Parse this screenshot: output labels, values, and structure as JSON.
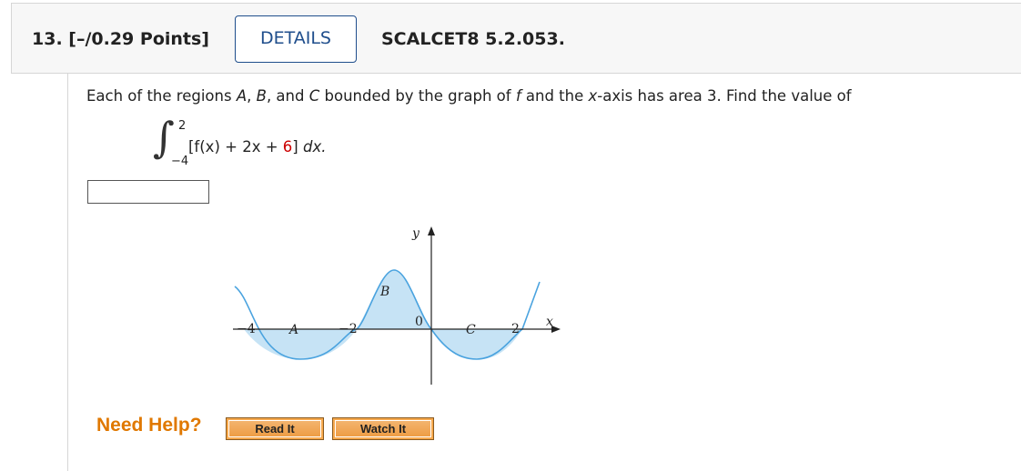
{
  "header": {
    "question_label": "13. [–/0.29 Points]",
    "details_label": "DETAILS",
    "code": "SCALCET8 5.2.053."
  },
  "problem": {
    "prompt_before_f": "Each of the regions ",
    "region_a": "A",
    "comma_sep": ", ",
    "region_b": "B",
    "and_sep": ", and ",
    "region_c": "C",
    "bounded_text": " bounded by the graph of ",
    "f_symbol": "f",
    "and_the": " and the ",
    "x_symbol": "x",
    "rest": "-axis has area 3. Find the value of",
    "integral": {
      "upper": "2",
      "lower": "−4",
      "integrand_before": "[f(x) + 2x + ",
      "integrand_red": "6",
      "integrand_after": "] ",
      "dx": "dx."
    },
    "answer_value": ""
  },
  "graph": {
    "y_axis_label": "y",
    "x_axis_label": "x",
    "tick_labels": [
      "−4",
      "−2",
      "0",
      "2"
    ],
    "region_labels": [
      "A",
      "B",
      "C"
    ],
    "fill_color": "#c6e3f5",
    "curve_color": "#4aa3df"
  },
  "help": {
    "label": "Need Help?",
    "read_it": "Read It",
    "watch_it": "Watch It"
  }
}
